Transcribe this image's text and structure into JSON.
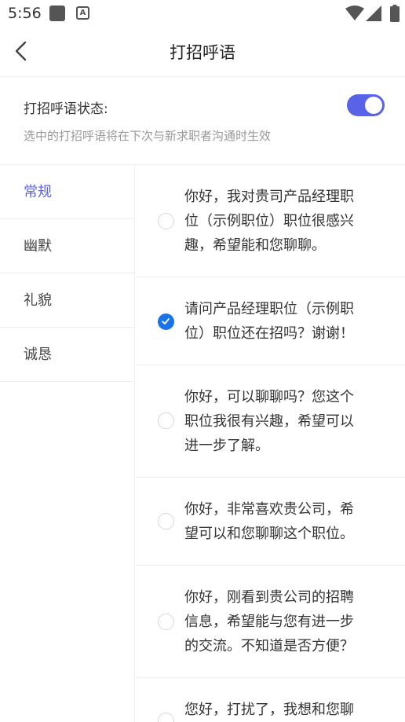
{
  "status_bar": {
    "time": "5:56",
    "notification_icons": [
      "square-icon",
      "a-badge-icon"
    ],
    "system_icons": [
      "wifi-icon",
      "signal-icon",
      "battery-icon"
    ]
  },
  "header": {
    "title": "打招呼语",
    "back_icon": "chevron-left-icon"
  },
  "greeting_status": {
    "label": "打招呼语状态:",
    "enabled": true,
    "hint": "选中的打招呼语将在下次与新求职者沟通时生效",
    "accent_color": "#5a63e8"
  },
  "categories": [
    {
      "label": "常规",
      "active": true
    },
    {
      "label": "幽默",
      "active": false
    },
    {
      "label": "礼貌",
      "active": false
    },
    {
      "label": "诚恳",
      "active": false
    }
  ],
  "greetings": [
    {
      "lines": [
        "你好，我对贵司产品经理职",
        "位（示例职位）职位很感兴",
        "趣，希望能和您聊聊。"
      ],
      "selected": false
    },
    {
      "lines": [
        "请问产品经理职位（示例职",
        "位）职位还在招吗？谢谢！"
      ],
      "selected": true
    },
    {
      "lines": [
        "你好，可以聊聊吗？您这个",
        "职位我很有兴趣，希望可以",
        "进一步了解。"
      ],
      "selected": false
    },
    {
      "lines": [
        "你好，非常喜欢贵公司，希",
        "望可以和您聊聊这个职位。"
      ],
      "selected": false
    },
    {
      "lines": [
        "你好，刚看到贵公司的招聘",
        "信息，希望能与您有进一步",
        "的交流。不知道是否方便？"
      ],
      "selected": false
    },
    {
      "lines": [
        "您好，打扰了，我想和您聊"
      ],
      "selected": false
    }
  ],
  "colors": {
    "check_color": "#1a73e8",
    "divider": "#eeeeee",
    "hint_text": "#999999"
  }
}
